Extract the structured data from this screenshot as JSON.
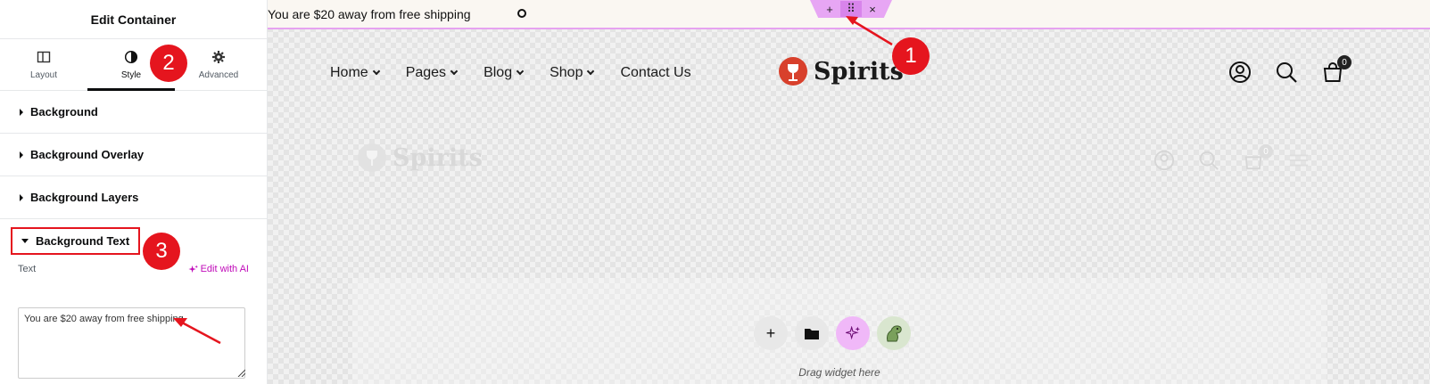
{
  "panel": {
    "title": "Edit Container",
    "tabs": [
      {
        "label": "Layout",
        "icon": "layout-icon"
      },
      {
        "label": "Style",
        "icon": "contrast-icon"
      },
      {
        "label": "Advanced",
        "icon": "gear-icon"
      }
    ],
    "sections": [
      {
        "label": "Background"
      },
      {
        "label": "Background Overlay"
      },
      {
        "label": "Background Layers"
      },
      {
        "label": "Background Text"
      }
    ],
    "text_label": "Text",
    "ai_label": "Edit with AI",
    "text_value": "You are $20 away from free shipping"
  },
  "canvas": {
    "topbar_text": "You are $20 away from free shipping",
    "handle": {
      "add": "+",
      "move": "⠿",
      "close": "×"
    },
    "nav": [
      "Home",
      "Pages",
      "Blog",
      "Shop",
      "Contact Us"
    ],
    "logo_text": "Spirits",
    "cart_count": "0",
    "drop_label": "Drag widget here"
  },
  "annotations": [
    "1",
    "2",
    "3"
  ],
  "colors": {
    "accent": "#e5151e",
    "editor_pink": "#e7a6f4",
    "ai_purple": "#c00bb9"
  }
}
